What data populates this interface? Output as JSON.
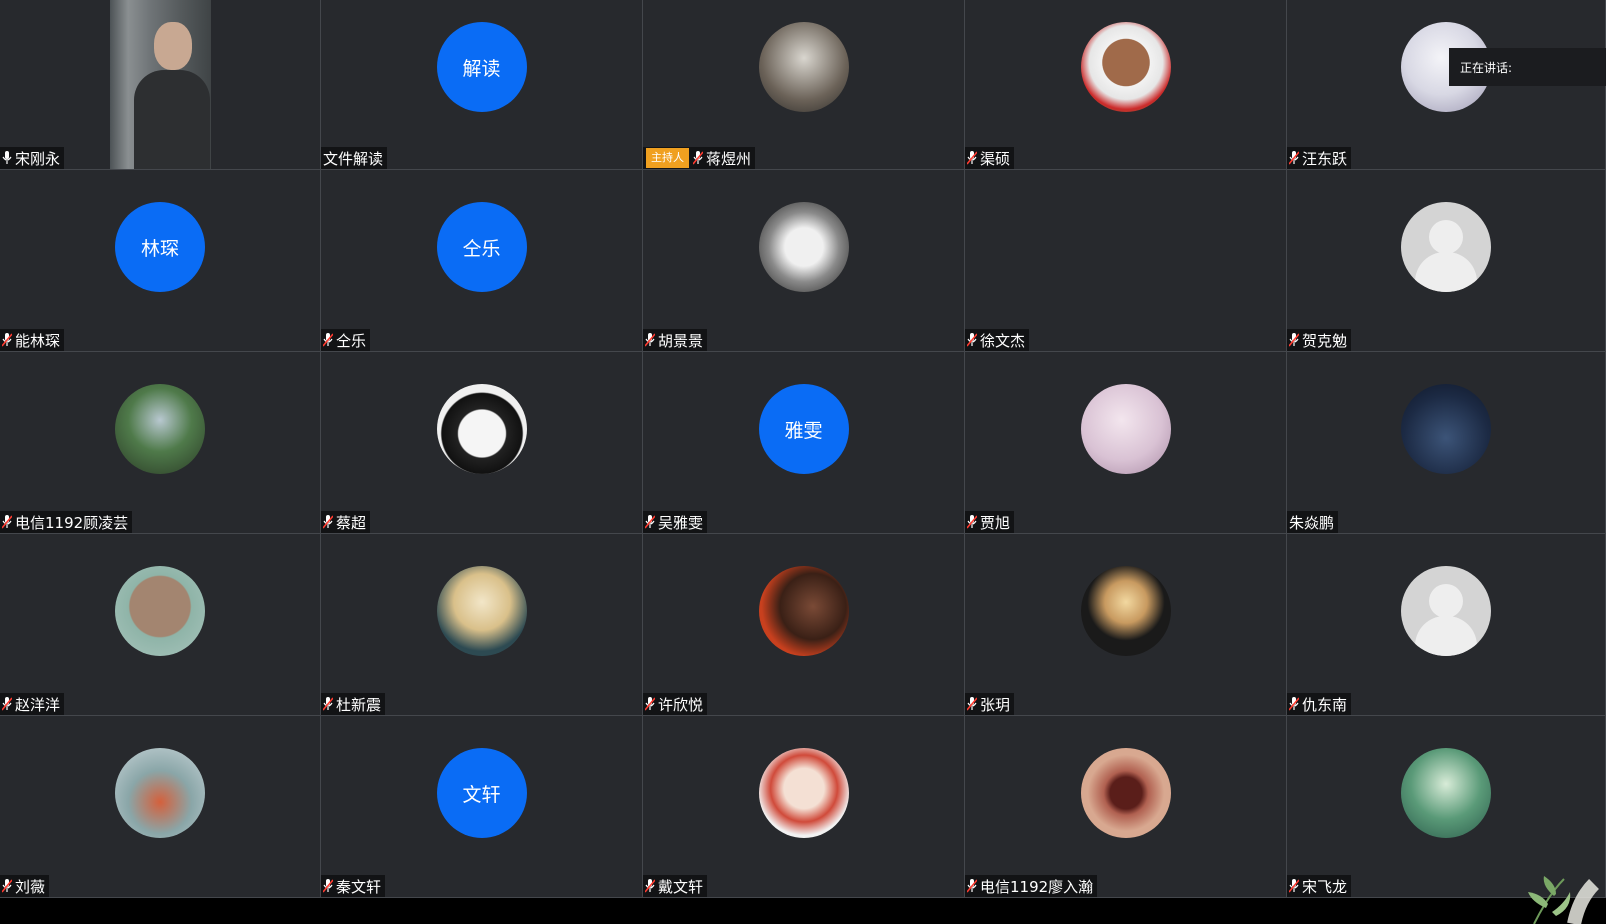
{
  "speaking_label": "正在讲话:",
  "host_badge_label": "主持人",
  "colors": {
    "tile_bg": "#27292d",
    "initials_bg": "#0a6cf5",
    "host_badge": "#f0a020",
    "muted_mic": "#ff3b30"
  },
  "participants": [
    {
      "name": "宋刚永",
      "avatar": "video",
      "mic": "on"
    },
    {
      "name": "文件解读",
      "avatar": "initials",
      "initials": "解读",
      "mic": "none"
    },
    {
      "name": "蒋煜州",
      "avatar": "photo",
      "mic": "muted",
      "host": true
    },
    {
      "name": "渠硕",
      "avatar": "photo",
      "mic": "muted"
    },
    {
      "name": "汪东跃",
      "avatar": "photo",
      "mic": "muted"
    },
    {
      "name": "能林琛",
      "avatar": "initials",
      "initials": "林琛",
      "mic": "muted"
    },
    {
      "name": "仝乐",
      "avatar": "initials",
      "initials": "仝乐",
      "mic": "muted"
    },
    {
      "name": "胡景景",
      "avatar": "photo",
      "mic": "muted"
    },
    {
      "name": " 徐文杰",
      "avatar": "none",
      "mic": "muted"
    },
    {
      "name": "贺克勉",
      "avatar": "default",
      "mic": "muted"
    },
    {
      "name": "电信1192顾凌芸",
      "avatar": "photo",
      "mic": "muted"
    },
    {
      "name": "蔡超",
      "avatar": "photo",
      "mic": "muted"
    },
    {
      "name": "吴雅雯",
      "avatar": "initials",
      "initials": "雅雯",
      "mic": "muted"
    },
    {
      "name": "贾旭",
      "avatar": "photo",
      "mic": "muted"
    },
    {
      "name": "朱焱鹏",
      "avatar": "photo",
      "mic": "none"
    },
    {
      "name": "赵洋洋",
      "avatar": "photo",
      "mic": "muted"
    },
    {
      "name": "杜新震",
      "avatar": "photo",
      "mic": "muted"
    },
    {
      "name": "许欣悦",
      "avatar": "photo",
      "mic": "muted"
    },
    {
      "name": "张玥",
      "avatar": "photo",
      "mic": "muted"
    },
    {
      "name": "仇东南",
      "avatar": "default",
      "mic": "muted"
    },
    {
      "name": "刘薇",
      "avatar": "photo",
      "mic": "muted"
    },
    {
      "name": "秦文轩",
      "avatar": "initials",
      "initials": "文轩",
      "mic": "muted"
    },
    {
      "name": "戴文轩",
      "avatar": "photo",
      "mic": "muted"
    },
    {
      "name": "电信1192廖入瀚",
      "avatar": "photo",
      "mic": "muted"
    },
    {
      "name": "宋飞龙",
      "avatar": "photo",
      "mic": "muted"
    }
  ]
}
